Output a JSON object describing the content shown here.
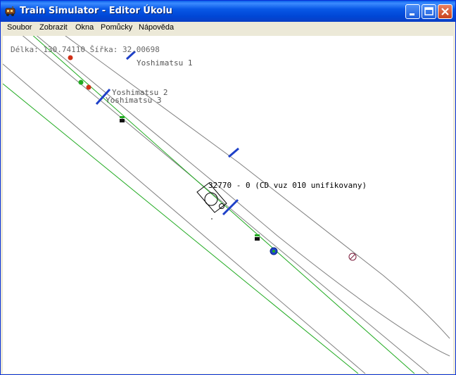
{
  "window": {
    "title": "Train Simulator - Editor Úkolu"
  },
  "menu": {
    "items": [
      "Soubor",
      "Zobrazit",
      "Okna",
      "Pomůcky",
      "Nápověda"
    ]
  },
  "map": {
    "coords_text": "Délka: 130.74110 Šířka: 32.00698",
    "labels": {
      "yoshimatsu1": "Yoshimatsu 1",
      "yoshimatsu2": "Yoshimatsu 2",
      "yoshimatsu3": "Yoshimatsu 3",
      "train": "32770 - 0 (CD vuz 010 unifikovany)"
    }
  },
  "colors": {
    "track": "#7f7f7f",
    "green_line": "#1faa1f",
    "marker_blue": "#1e40c8",
    "signal_red": "#d03018",
    "signal_green": "#22aa22"
  }
}
